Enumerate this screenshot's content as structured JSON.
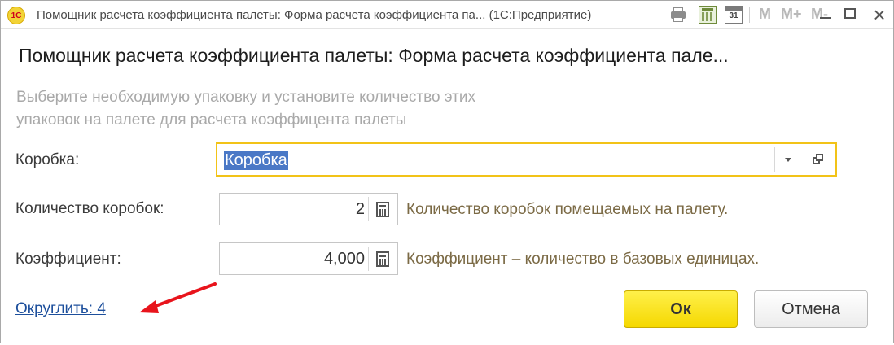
{
  "window": {
    "title": "Помощник расчета коэффициента палеты: Форма расчета коэффициента па... (1С:Предприятие)",
    "logo_text": "1С",
    "calendar_day": "31",
    "memory_buttons": [
      "M",
      "M+",
      "M-"
    ],
    "close_glyph": "×"
  },
  "form": {
    "title": "Помощник расчета коэффициента палеты: Форма расчета коэффициента пале...",
    "hint_line1": "Выберите необходимую упаковку и установите количество этих",
    "hint_line2": "упаковок на палете для расчета коэффицента палеты",
    "box_label": "Коробка:",
    "box_value": "Коробка",
    "qty_label": "Количество коробок:",
    "qty_value": "2",
    "qty_note": "Количество коробок помещаемых на палету.",
    "coef_label": "Коэффициент:",
    "coef_value": "4,000",
    "coef_note": "Коэффициент – количество в базовых единицах.",
    "round_link": "Округлить: 4",
    "ok_label": "Ок",
    "cancel_label": "Отмена"
  },
  "colors": {
    "accent_border": "#f2c318",
    "ok_button": "#f5d800",
    "note_text": "#7b6a45",
    "link": "#1d4f9c",
    "arrow": "#e8141c"
  }
}
